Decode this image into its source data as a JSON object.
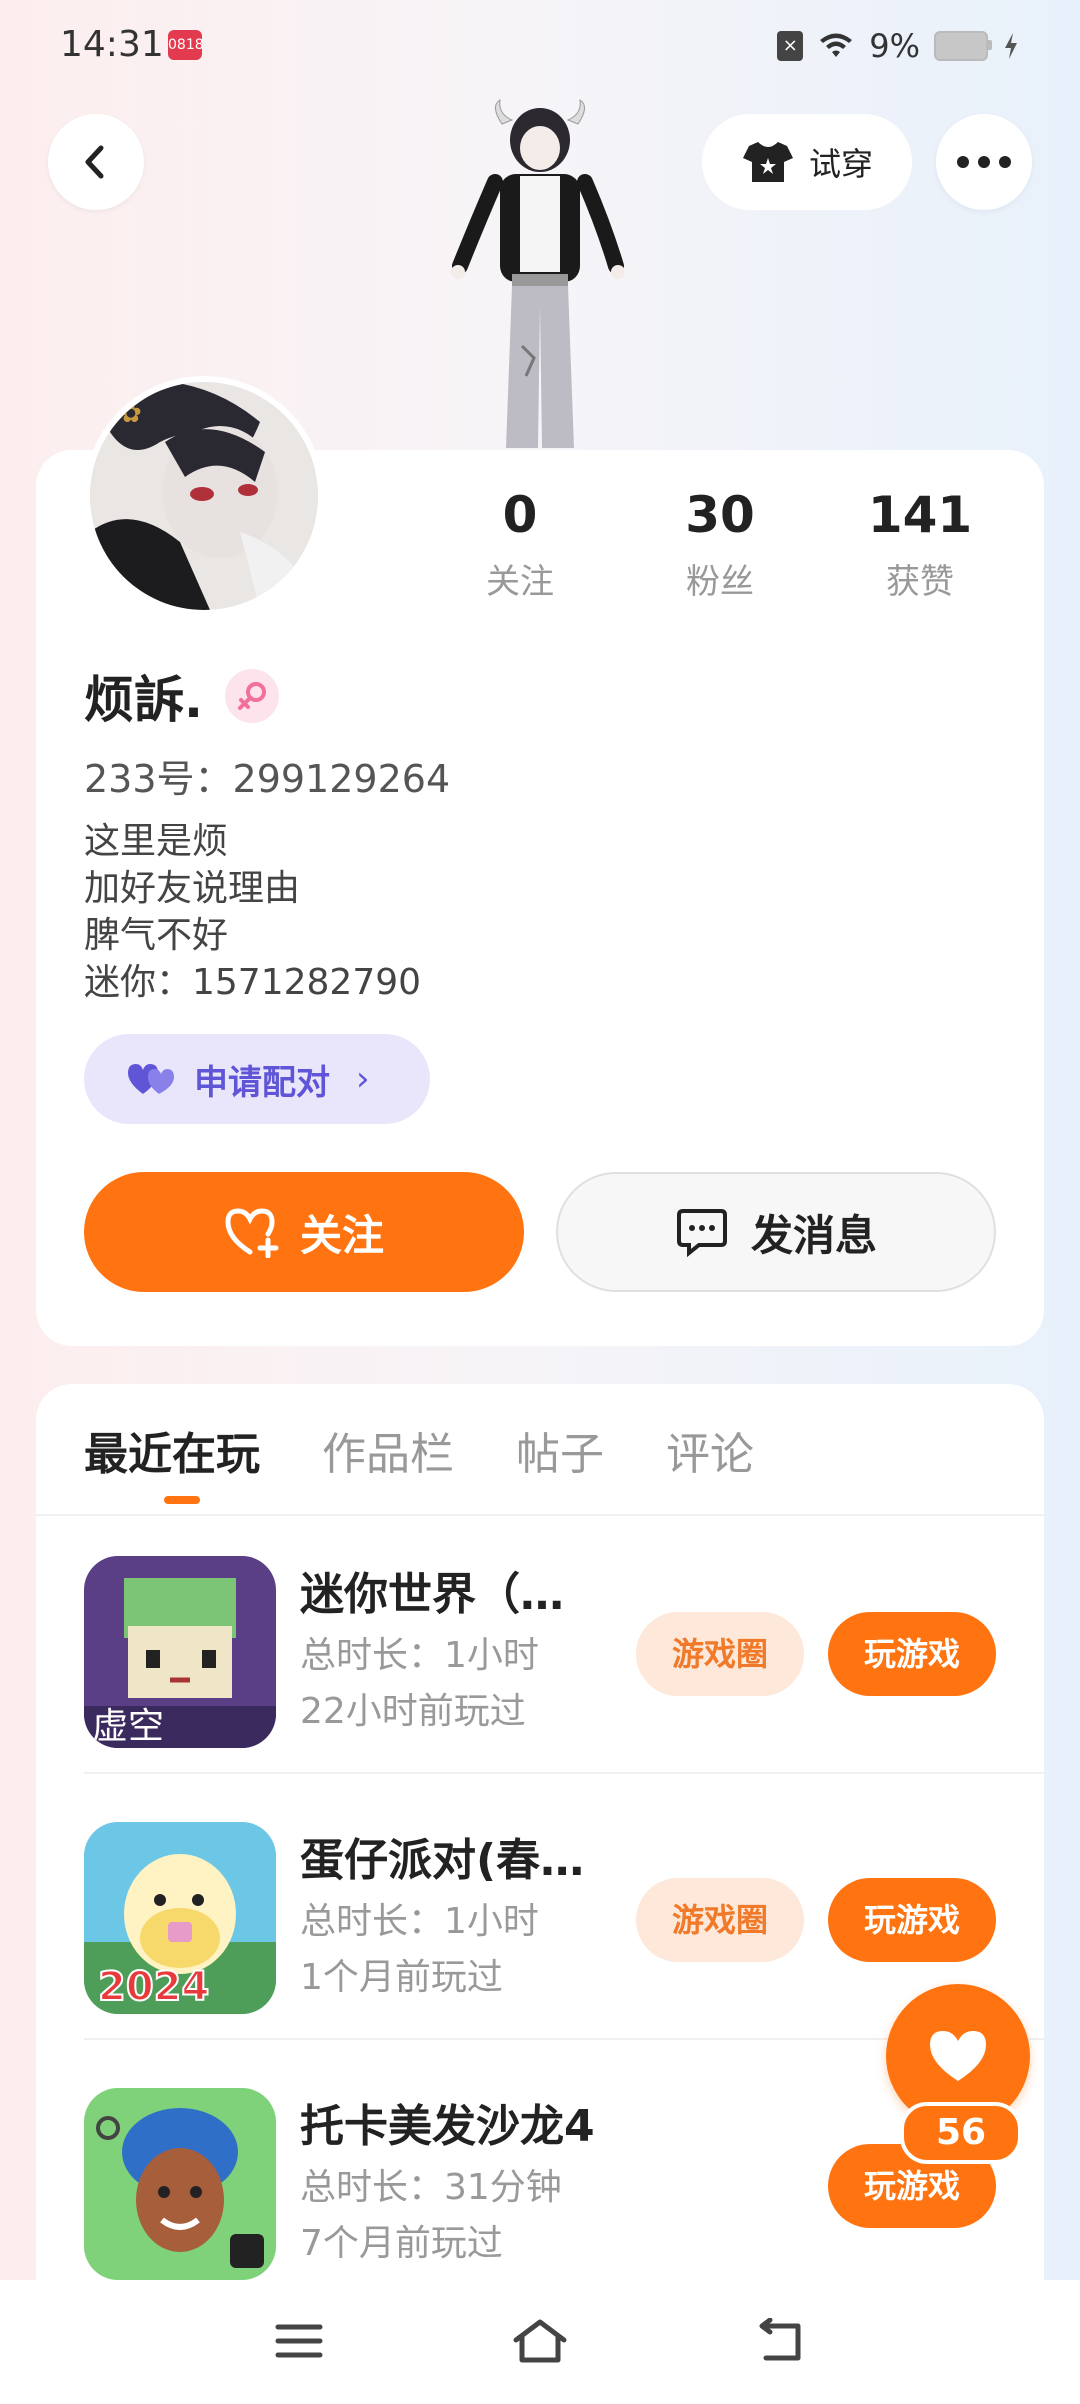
{
  "status_bar": {
    "time": "14:31",
    "app_badge": "0818 Oppo",
    "battery": "9%"
  },
  "top": {
    "tryon_label": "试穿"
  },
  "profile": {
    "stats": [
      {
        "value": "0",
        "label": "关注"
      },
      {
        "value": "30",
        "label": "粉丝"
      },
      {
        "value": "141",
        "label": "获赞"
      }
    ],
    "name": "烦訴.",
    "uid": "233号：299129264",
    "bio": [
      "这里是烦",
      "加好友说理由",
      "脾气不好",
      "迷你：1571282790"
    ],
    "pair_label": "申请配对",
    "follow_label": "关注",
    "message_label": "发消息"
  },
  "tabs": [
    "最近在玩",
    "作品栏",
    "帖子",
    "评论"
  ],
  "games": [
    {
      "title": "迷你世界（…",
      "duration": "总时长：1小时",
      "last_played": "22小时前玩过",
      "circle_label": "游戏圈",
      "play_label": "玩游戏"
    },
    {
      "title": "蛋仔派对(春…",
      "duration": "总时长：1小时",
      "last_played": "1个月前玩过",
      "circle_label": "游戏圈",
      "play_label": "玩游戏"
    },
    {
      "title": "托卡美发沙龙4",
      "duration": "总时长：31分钟",
      "last_played": "7个月前玩过",
      "play_label": "玩游戏"
    }
  ],
  "like_count": "56",
  "colors": {
    "accent": "#ff7411",
    "pair_purple": "#5f55d6"
  }
}
